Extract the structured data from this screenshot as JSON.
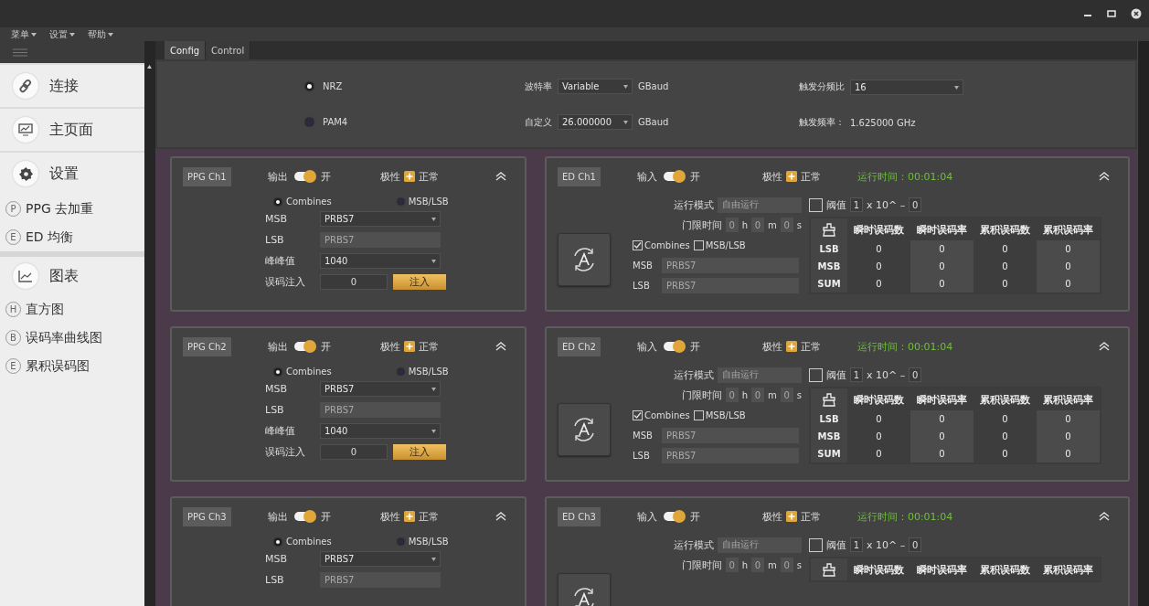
{
  "menu": [
    {
      "label": "菜单"
    },
    {
      "label": "设置"
    },
    {
      "label": "帮助"
    }
  ],
  "sidebar": {
    "items": [
      {
        "kind": "header",
        "label": "连接"
      },
      {
        "kind": "header",
        "label": "主页面"
      },
      {
        "kind": "header",
        "label": "设置"
      },
      {
        "kind": "sub",
        "letter": "P",
        "label": "PPG 去加重"
      },
      {
        "kind": "sub",
        "letter": "E",
        "label": "ED 均衡"
      },
      {
        "kind": "header",
        "label": "图表"
      },
      {
        "kind": "sub",
        "letter": "H",
        "label": "直方图"
      },
      {
        "kind": "sub",
        "letter": "B",
        "label": "误码率曲线图"
      },
      {
        "kind": "sub",
        "letter": "E",
        "label": "累积误码图"
      }
    ]
  },
  "tabs": [
    {
      "label": "Config",
      "selected": true
    },
    {
      "label": "Control",
      "selected": false
    }
  ],
  "config": {
    "modulation": [
      {
        "label": "NRZ",
        "selected": true
      },
      {
        "label": "PAM4",
        "selected": false
      }
    ],
    "baud_rate": {
      "label": "波特率",
      "value": "Variable",
      "unit": "GBaud"
    },
    "custom": {
      "label": "自定义",
      "value": "26.000000",
      "unit": "GBaud"
    },
    "trigger_divider": {
      "label": "触发分频比",
      "value": "16"
    },
    "trigger_freq": {
      "label": "触发频率：",
      "value": "1.625000 GHz"
    }
  },
  "channels": [
    {
      "ppg": {
        "label": "PPG Ch1",
        "output_label": "输出",
        "output_on": true,
        "output_text": "开",
        "polarity_label": "极性",
        "polarity_text": "正常",
        "modes": [
          {
            "label": "Combines",
            "selected": true
          },
          {
            "label": "MSB/LSB",
            "selected": false
          }
        ],
        "fields": [
          {
            "label": "MSB",
            "value": "PRBS7",
            "disabled": false
          },
          {
            "label": "LSB",
            "value": "PRBS7",
            "disabled": true
          },
          {
            "label": "峰峰值",
            "value": "1040",
            "disabled": false
          }
        ],
        "inject": {
          "label": "误码注入",
          "value": "0",
          "button": "注入"
        }
      },
      "ed": {
        "label": "ED Ch1",
        "input_label": "输入",
        "input_on": true,
        "input_text": "开",
        "polarity_label": "极性",
        "polarity_text": "正常",
        "run_time": "运行时间：00:01:04",
        "run_mode": {
          "label": "运行模式",
          "value": "自由运行"
        },
        "gate": {
          "label": "门限时间",
          "parts": [
            {
              "value": "0",
              "unit": "h"
            },
            {
              "value": "0",
              "unit": "m"
            },
            {
              "value": "0",
              "unit": "s"
            }
          ]
        },
        "checks": [
          {
            "label": "Combines",
            "checked": true
          },
          {
            "label": "MSB/LSB",
            "checked": false
          }
        ],
        "fields": [
          {
            "label": "MSB",
            "value": "PRBS7"
          },
          {
            "label": "LSB",
            "value": "PRBS7"
          }
        ],
        "threshold": {
          "checked": false,
          "label": "阈值",
          "mantissa": "1",
          "middle": "x 10^ –",
          "exponent": "0"
        },
        "table": {
          "columns": [
            "瞬时误码数",
            "瞬时误码率",
            "累积误码数",
            "累积误码率"
          ],
          "rows": [
            {
              "label": "LSB",
              "values": [
                "0",
                "0",
                "0",
                "0"
              ]
            },
            {
              "label": "MSB",
              "values": [
                "0",
                "0",
                "0",
                "0"
              ]
            },
            {
              "label": "SUM",
              "values": [
                "0",
                "0",
                "0",
                "0"
              ]
            }
          ]
        }
      }
    },
    {
      "ppg": {
        "label": "PPG Ch2",
        "output_label": "输出",
        "output_on": true,
        "output_text": "开",
        "polarity_label": "极性",
        "polarity_text": "正常",
        "modes": [
          {
            "label": "Combines",
            "selected": true
          },
          {
            "label": "MSB/LSB",
            "selected": false
          }
        ],
        "fields": [
          {
            "label": "MSB",
            "value": "PRBS7",
            "disabled": false
          },
          {
            "label": "LSB",
            "value": "PRBS7",
            "disabled": true
          },
          {
            "label": "峰峰值",
            "value": "1040",
            "disabled": false
          }
        ],
        "inject": {
          "label": "误码注入",
          "value": "0",
          "button": "注入"
        }
      },
      "ed": {
        "label": "ED Ch2",
        "input_label": "输入",
        "input_on": true,
        "input_text": "开",
        "polarity_label": "极性",
        "polarity_text": "正常",
        "run_time": "运行时间：00:01:04",
        "run_mode": {
          "label": "运行模式",
          "value": "自由运行"
        },
        "gate": {
          "label": "门限时间",
          "parts": [
            {
              "value": "0",
              "unit": "h"
            },
            {
              "value": "0",
              "unit": "m"
            },
            {
              "value": "0",
              "unit": "s"
            }
          ]
        },
        "checks": [
          {
            "label": "Combines",
            "checked": true
          },
          {
            "label": "MSB/LSB",
            "checked": false
          }
        ],
        "fields": [
          {
            "label": "MSB",
            "value": "PRBS7"
          },
          {
            "label": "LSB",
            "value": "PRBS7"
          }
        ],
        "threshold": {
          "checked": false,
          "label": "阈值",
          "mantissa": "1",
          "middle": "x 10^ –",
          "exponent": "0"
        },
        "table": {
          "columns": [
            "瞬时误码数",
            "瞬时误码率",
            "累积误码数",
            "累积误码率"
          ],
          "rows": [
            {
              "label": "LSB",
              "values": [
                "0",
                "0",
                "0",
                "0"
              ]
            },
            {
              "label": "MSB",
              "values": [
                "0",
                "0",
                "0",
                "0"
              ]
            },
            {
              "label": "SUM",
              "values": [
                "0",
                "0",
                "0",
                "0"
              ]
            }
          ]
        }
      }
    },
    {
      "ppg": {
        "label": "PPG Ch3",
        "output_label": "输出",
        "output_on": true,
        "output_text": "开",
        "polarity_label": "极性",
        "polarity_text": "正常",
        "modes": [
          {
            "label": "Combines",
            "selected": true
          },
          {
            "label": "MSB/LSB",
            "selected": false
          }
        ],
        "fields": [
          {
            "label": "MSB",
            "value": "PRBS7",
            "disabled": false
          },
          {
            "label": "LSB",
            "value": "PRBS7",
            "disabled": true
          }
        ]
      },
      "ed": {
        "label": "ED Ch3",
        "input_label": "输入",
        "input_on": true,
        "input_text": "开",
        "polarity_label": "极性",
        "polarity_text": "正常",
        "run_time": "运行时间：00:01:04",
        "run_mode": {
          "label": "运行模式",
          "value": "自由运行"
        },
        "gate": {
          "label": "门限时间",
          "parts": [
            {
              "value": "0",
              "unit": "h"
            },
            {
              "value": "0",
              "unit": "m"
            },
            {
              "value": "0",
              "unit": "s"
            }
          ]
        },
        "threshold": {
          "checked": false,
          "label": "阈值",
          "mantissa": "1",
          "middle": "x 10^ –",
          "exponent": "0"
        },
        "table": {
          "columns": [
            "瞬时误码数",
            "瞬时误码率",
            "累积误码数",
            "累积误码率"
          ]
        }
      }
    }
  ]
}
